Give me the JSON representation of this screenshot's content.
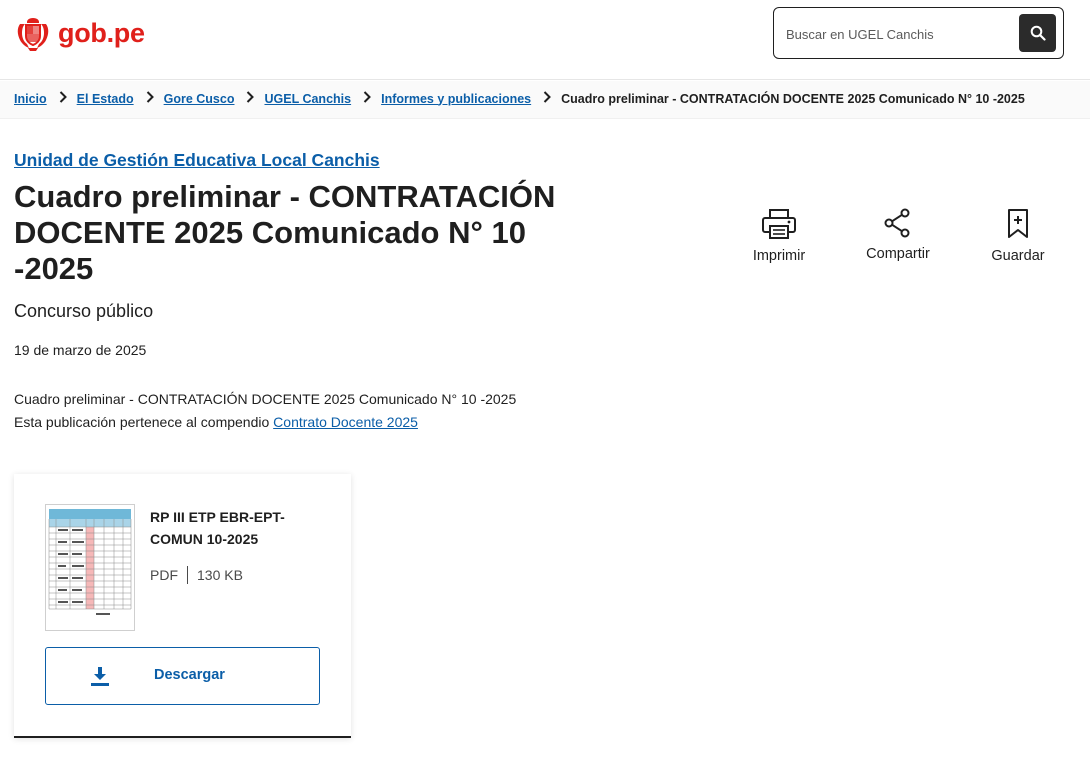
{
  "header": {
    "logo_text": "gob.pe",
    "search_placeholder": "Buscar en UGEL Canchis"
  },
  "breadcrumb": {
    "items": [
      "Inicio",
      "El Estado",
      "Gore Cusco",
      "UGEL Canchis",
      "Informes y publicaciones"
    ],
    "current": "Cuadro preliminar - CONTRATACIÓN DOCENTE 2025 Comunicado N° 10 -2025"
  },
  "main": {
    "institution": "Unidad de Gestión Educativa Local Canchis",
    "title": "Cuadro preliminar - CONTRATACIÓN DOCENTE 2025 Comunicado N° 10 -2025",
    "category": "Concurso público",
    "date": "19 de marzo de 2025",
    "description": "Cuadro preliminar - CONTRATACIÓN DOCENTE 2025 Comunicado N° 10 -2025",
    "compendium_prefix": "Esta publicación pertenece al compendio ",
    "compendium_link": "Contrato Docente 2025"
  },
  "actions": {
    "print": "Imprimir",
    "share": "Compartir",
    "save": "Guardar"
  },
  "document": {
    "name": "RP III ETP EBR-EPT-COMUN 10-2025",
    "type": "PDF",
    "size": "130 KB",
    "download_label": "Descargar"
  },
  "colors": {
    "brand_red": "#e0201b",
    "link_blue": "#0b5ea8",
    "text_dark": "#1f1f1f"
  }
}
